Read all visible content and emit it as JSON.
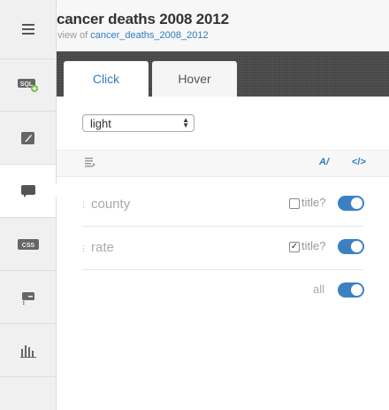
{
  "header": {
    "title": "cancer deaths 2008 2012",
    "view_of_label": "view of",
    "view_of_link": "cancer_deaths_2008_2012"
  },
  "sidebar": {
    "items": [
      {
        "name": "menu",
        "icon": "hamburger-icon"
      },
      {
        "name": "sql",
        "icon": "sql-icon"
      },
      {
        "name": "wizard",
        "icon": "brush-icon"
      },
      {
        "name": "infowindow",
        "icon": "speech-bubble-icon",
        "active": true
      },
      {
        "name": "css",
        "icon": "css-icon"
      },
      {
        "name": "legend",
        "icon": "legend-icon"
      },
      {
        "name": "histogram",
        "icon": "histogram-icon"
      }
    ],
    "sql_badge": "SQL",
    "css_badge": "CSS"
  },
  "tabs": [
    {
      "label": "Click",
      "active": true
    },
    {
      "label": "Hover",
      "active": false
    }
  ],
  "theme_select": {
    "value": "light"
  },
  "toolbar": {
    "ai_label": "A/",
    "code_label": "</>"
  },
  "fields": [
    {
      "name": "county",
      "title_checked": false,
      "title_label": "title?",
      "enabled": true
    },
    {
      "name": "rate",
      "title_checked": true,
      "title_label": "title?",
      "enabled": true
    }
  ],
  "all_toggle": {
    "label": "all",
    "enabled": true
  },
  "colors": {
    "accent": "#2e7cbf",
    "toggle": "#3c80c4",
    "tabbar": "#484848"
  }
}
